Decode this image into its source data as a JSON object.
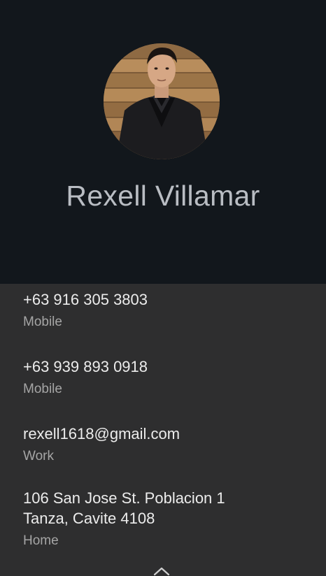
{
  "contact": {
    "name": "Rexell Villamar",
    "avatar_icon": "contact-photo"
  },
  "entries": [
    {
      "value": "+63 916 305 3803",
      "label": "Mobile"
    },
    {
      "value": "+63 939 893 0918",
      "label": "Mobile"
    },
    {
      "value": "rexell1618@gmail.com",
      "label": "Work"
    },
    {
      "value": "106 San Jose St. Poblacion 1\nTanza, Cavite 4108",
      "label": "Home"
    }
  ],
  "footer": {
    "expand_icon": "chevron-up-icon"
  },
  "colors": {
    "header_background": "#12171c",
    "details_background": "#2e2e2f",
    "name_text": "#b9bdc3",
    "value_text": "#ececec",
    "label_text": "#a5a5a5"
  }
}
